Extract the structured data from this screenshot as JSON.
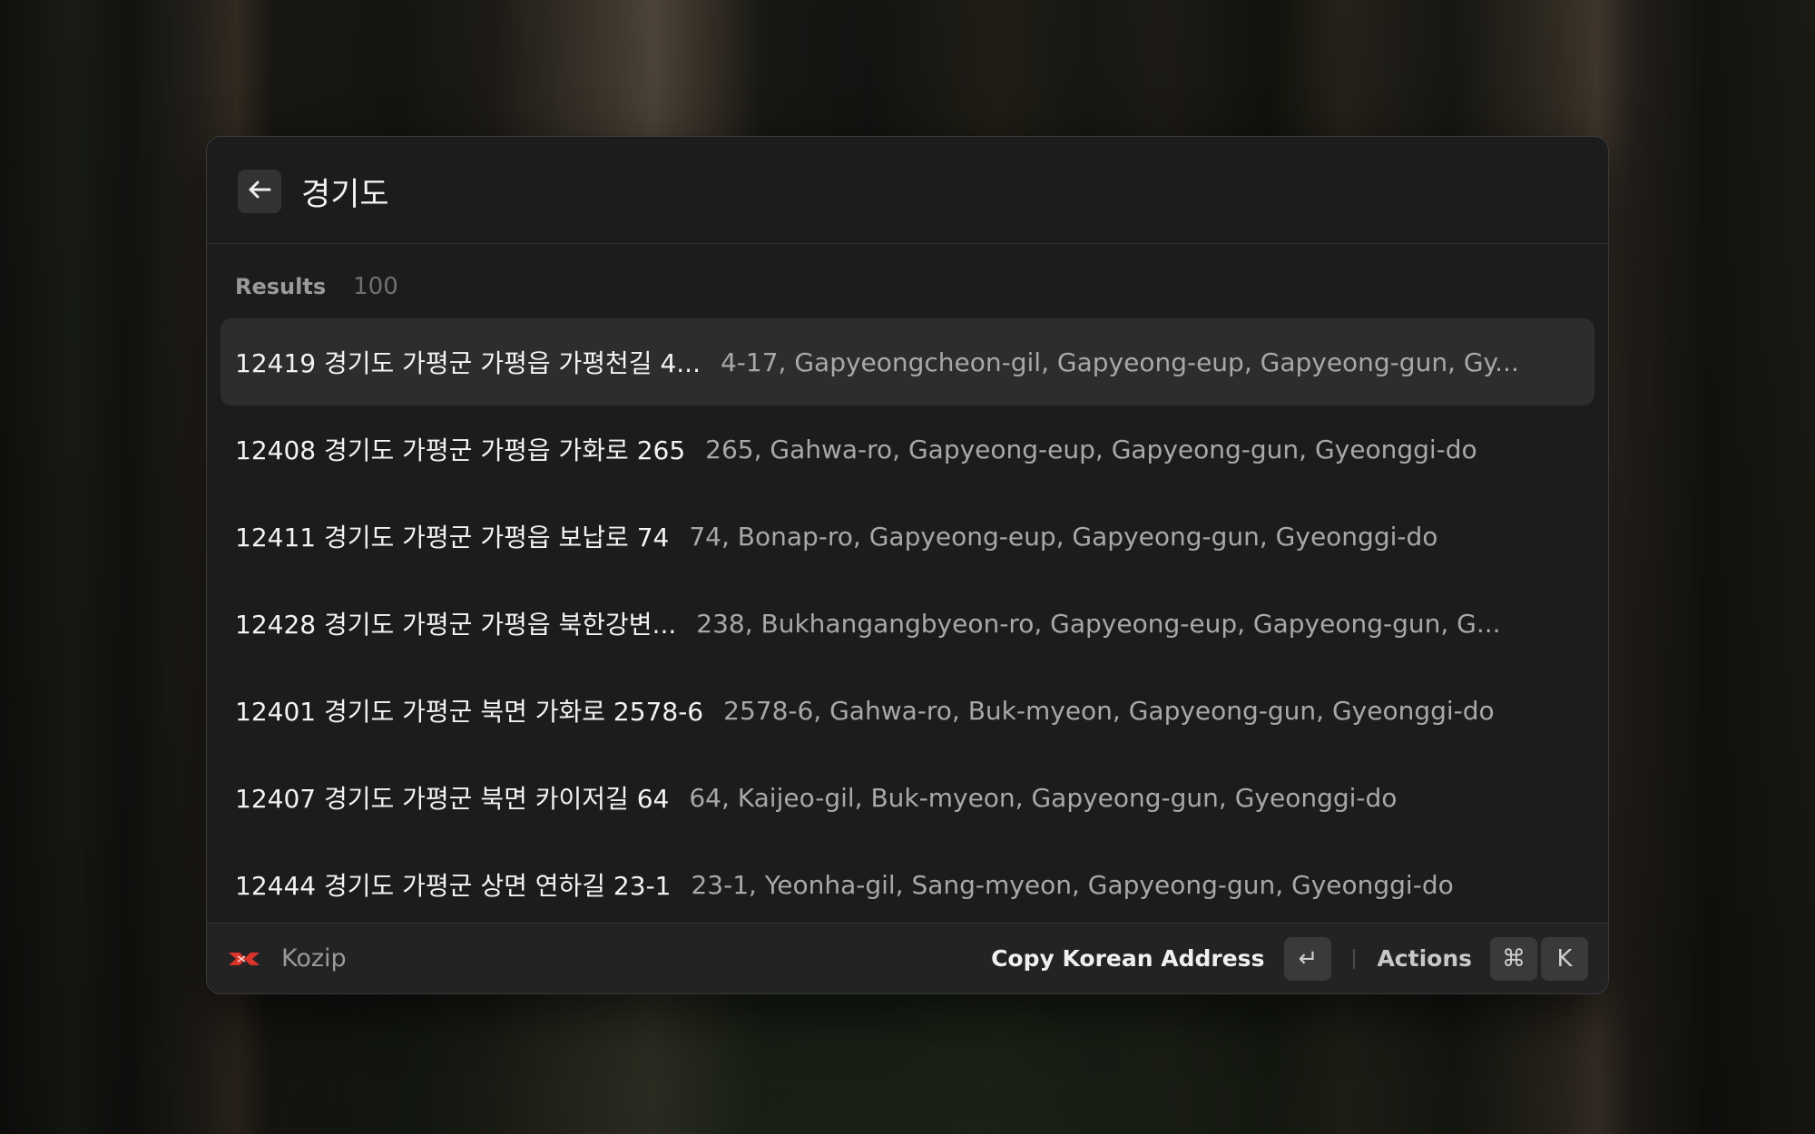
{
  "search": {
    "value": "경기도",
    "back_icon": "arrow-left-icon"
  },
  "section": {
    "title": "Results",
    "count": "100"
  },
  "results": [
    {
      "title": "12419 경기도 가평군 가평읍 가평천길 4...",
      "subtitle": "4-17, Gapyeongcheon-gil, Gapyeong-eup, Gapyeong-gun, Gy...",
      "selected": true
    },
    {
      "title": "12408 경기도 가평군 가평읍 가화로 265",
      "subtitle": "265, Gahwa-ro, Gapyeong-eup, Gapyeong-gun, Gyeonggi-do",
      "selected": false
    },
    {
      "title": "12411 경기도 가평군 가평읍 보납로 74",
      "subtitle": "74, Bonap-ro, Gapyeong-eup, Gapyeong-gun, Gyeonggi-do",
      "selected": false
    },
    {
      "title": "12428 경기도 가평군 가평읍 북한강변...",
      "subtitle": "238, Bukhangangbyeon-ro, Gapyeong-eup, Gapyeong-gun, G...",
      "selected": false
    },
    {
      "title": "12401 경기도 가평군 북면 가화로 2578-6",
      "subtitle": "2578-6, Gahwa-ro, Buk-myeon, Gapyeong-gun, Gyeonggi-do",
      "selected": false
    },
    {
      "title": "12407 경기도 가평군 북면 카이저길 64",
      "subtitle": "64, Kaijeo-gil, Buk-myeon, Gapyeong-gun, Gyeonggi-do",
      "selected": false
    },
    {
      "title": "12444 경기도 가평군 상면 연하길 23-1",
      "subtitle": "23-1, Yeonha-gil, Sang-myeon, Gapyeong-gun, Gyeonggi-do",
      "selected": false
    }
  ],
  "footer": {
    "app_name": "Kozip",
    "app_icon": "kozip-logo-icon",
    "primary_action": "Copy Korean Address",
    "primary_key": "↵",
    "actions_label": "Actions",
    "actions_keys": [
      "⌘",
      "K"
    ]
  },
  "colors": {
    "window_bg": "#1c1c1c",
    "selected_row_bg": "#2d2d2d",
    "logo_red": "#d9342b"
  }
}
